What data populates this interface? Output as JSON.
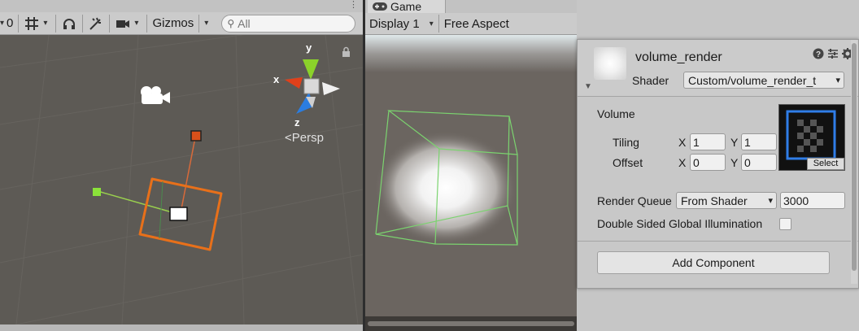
{
  "scene": {
    "toolbar": {
      "left_value": "0",
      "gizmos_label": "Gizmos",
      "search_placeholder": "All"
    },
    "gizmo": {
      "x_label": "x",
      "y_label": "y",
      "z_label": "z",
      "persp_label": "<Persp"
    }
  },
  "game": {
    "tab_label": "Game",
    "display_label": "Display 1",
    "aspect_label": "Free Aspect"
  },
  "inspector": {
    "material_name": "volume_render",
    "shader_label": "Shader",
    "shader_value": "Custom/volume_render_t",
    "volume_label": "Volume",
    "tiling_label": "Tiling",
    "offset_label": "Offset",
    "tiling": {
      "x_label": "X",
      "x": "1",
      "y_label": "Y",
      "y": "1"
    },
    "offset": {
      "x_label": "X",
      "x": "0",
      "y_label": "Y",
      "y": "0"
    },
    "select_label": "Select",
    "render_queue_label": "Render Queue",
    "render_queue_mode": "From Shader",
    "render_queue_value": "3000",
    "double_sided_label": "Double Sided Global Illumination",
    "add_component_label": "Add Component"
  },
  "colors": {
    "scene_bg": "#5d5a55",
    "selection_orange": "#e8701a",
    "bounds_green": "#7bd36f",
    "axis_x": "#e0401a",
    "axis_y": "#8bd22a",
    "axis_z": "#2b7de0"
  }
}
